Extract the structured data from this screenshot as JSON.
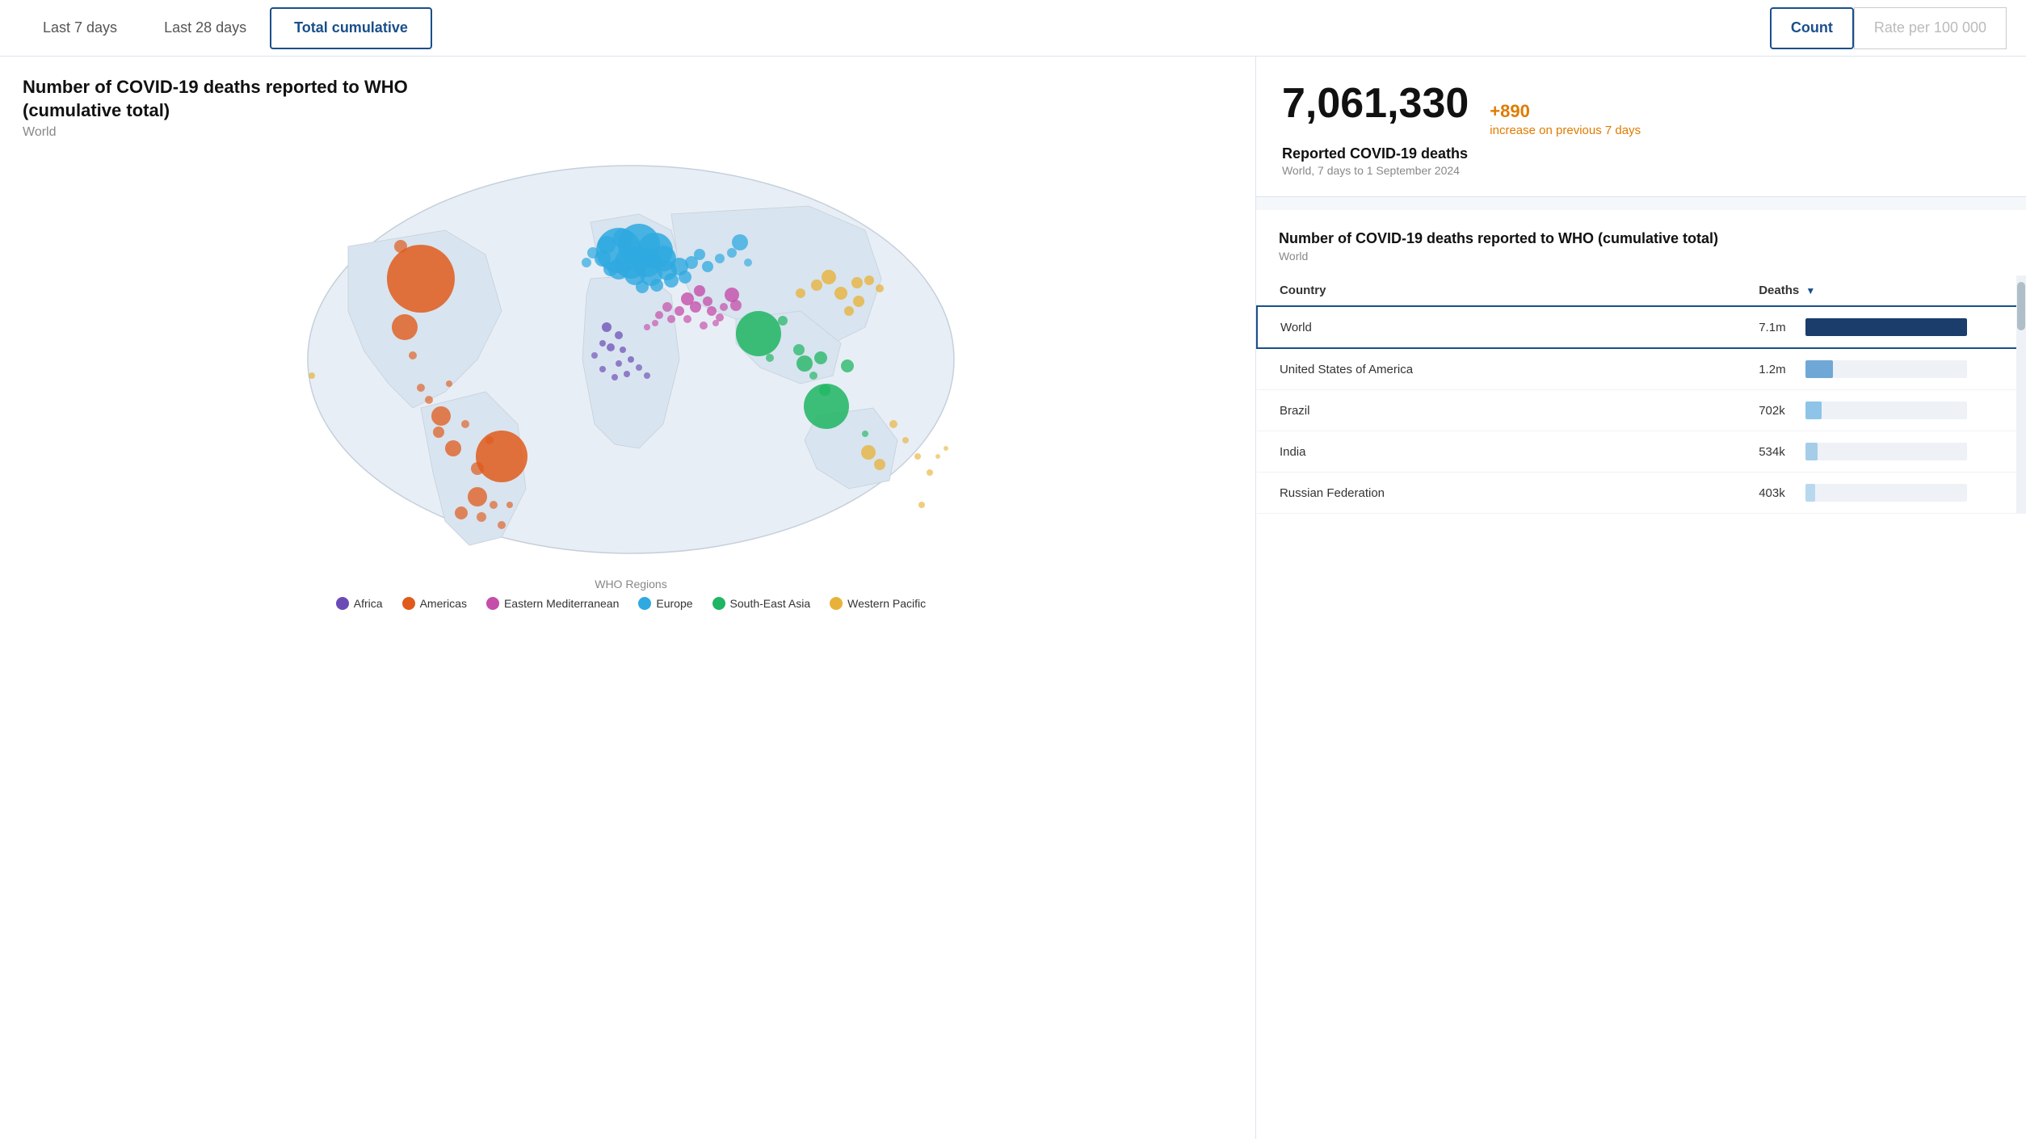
{
  "header": {
    "tabs": [
      {
        "label": "Last 7 days",
        "active": false
      },
      {
        "label": "Last 28 days",
        "active": false
      },
      {
        "label": "Total cumulative",
        "active": true
      }
    ],
    "view_toggle": [
      {
        "label": "Count",
        "active": true
      },
      {
        "label": "Rate per 100 000",
        "active": false
      }
    ]
  },
  "chart": {
    "title": "Number of COVID-19 deaths reported to WHO (cumulative total)",
    "subtitle": "World"
  },
  "legend": {
    "title": "WHO Regions",
    "items": [
      {
        "label": "Africa",
        "color": "#6a4bb5"
      },
      {
        "label": "Americas",
        "color": "#e05a1b"
      },
      {
        "label": "Eastern Mediterranean",
        "color": "#c44eaa"
      },
      {
        "label": "Europe",
        "color": "#2fa9e0"
      },
      {
        "label": "South-East Asia",
        "color": "#1fb562"
      },
      {
        "label": "Western Pacific",
        "color": "#e8b23a"
      }
    ]
  },
  "stats": {
    "big_number": "7,061,330",
    "change": "+890",
    "change_label": "increase on previous 7 days",
    "stat_label": "Reported COVID-19 deaths",
    "stat_period": "World, 7 days to 1 September 2024"
  },
  "table": {
    "title": "Number of COVID-19 deaths reported to WHO (cumulative total)",
    "subtitle": "World",
    "columns": [
      "Country",
      "Deaths"
    ],
    "rows": [
      {
        "country": "World",
        "value": "7.1m",
        "bar_pct": 100,
        "bar_class": "bar-world",
        "highlighted": true
      },
      {
        "country": "United States of America",
        "value": "1.2m",
        "bar_pct": 17,
        "bar_class": "bar-usa",
        "highlighted": false
      },
      {
        "country": "Brazil",
        "value": "702k",
        "bar_pct": 10,
        "bar_class": "bar-brazil",
        "highlighted": false
      },
      {
        "country": "India",
        "value": "534k",
        "bar_pct": 7.5,
        "bar_class": "bar-india",
        "highlighted": false
      },
      {
        "country": "Russian Federation",
        "value": "403k",
        "bar_pct": 5.7,
        "bar_class": "bar-russia",
        "highlighted": false
      }
    ]
  }
}
